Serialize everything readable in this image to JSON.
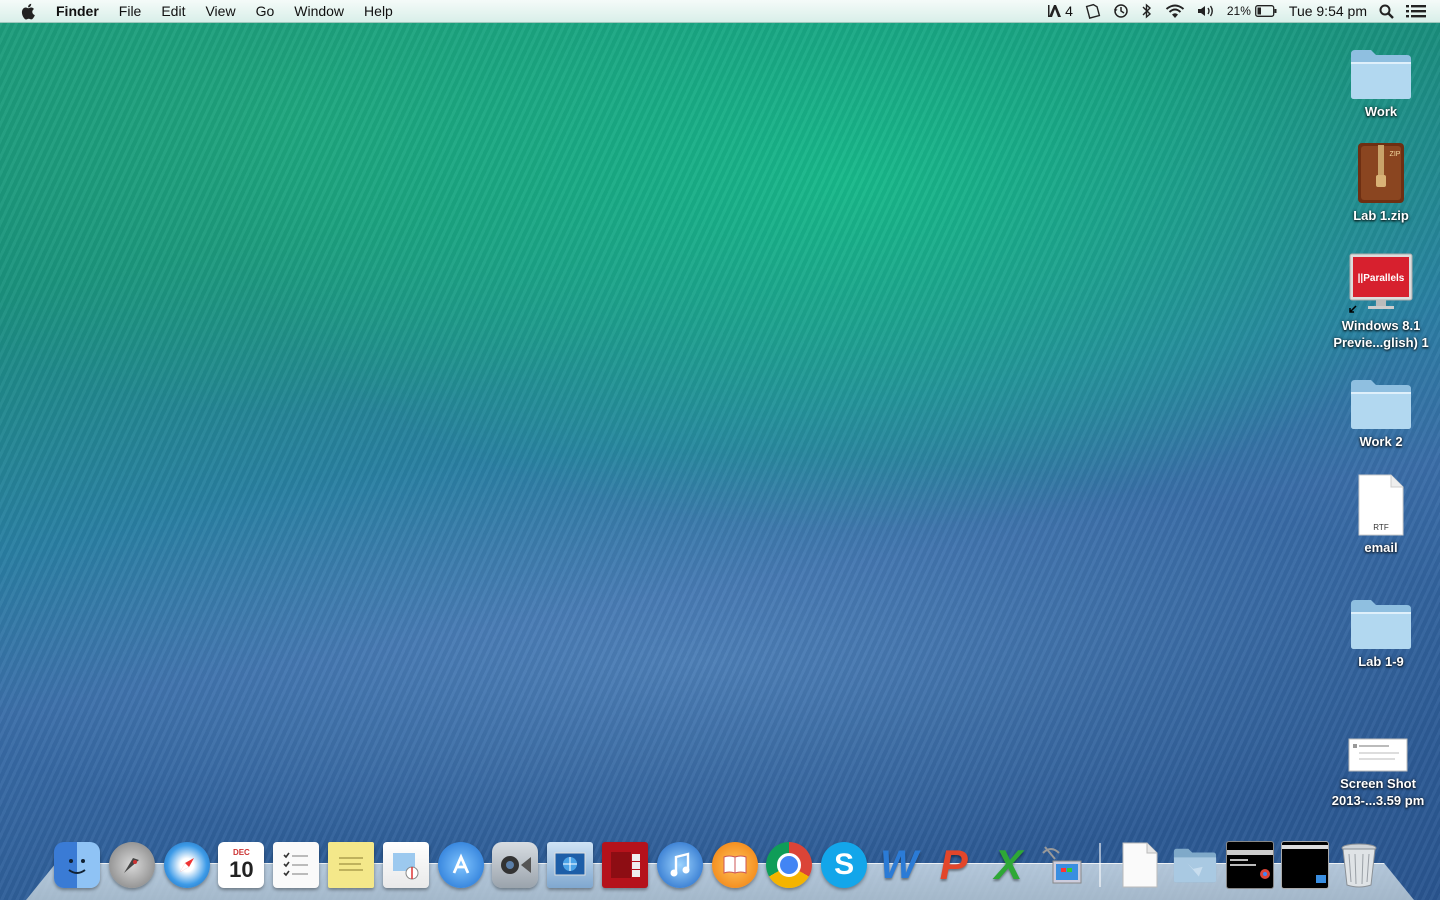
{
  "menubar": {
    "app_name": "Finder",
    "menus": [
      "File",
      "Edit",
      "View",
      "Go",
      "Window",
      "Help"
    ],
    "status": {
      "adobe_count": "4",
      "battery_percent": "21%",
      "clock": "Tue 9:54 pm"
    },
    "icons": [
      "apple-icon",
      "adobe-icon",
      "notifications-icon",
      "time-machine-icon",
      "bluetooth-icon",
      "wifi-icon",
      "volume-icon",
      "battery-icon",
      "spotlight-icon",
      "notification-center-icon"
    ]
  },
  "desktop": {
    "items": [
      {
        "label": "Work",
        "type": "folder-icon"
      },
      {
        "label": "Lab 1.zip",
        "type": "zip-icon"
      },
      {
        "label": "Windows 8.1 Previe...glish) 1",
        "type": "parallels-vm-icon",
        "badge": "||Parallels"
      },
      {
        "label": "Work 2",
        "type": "folder-icon"
      },
      {
        "label": "email",
        "type": "rtf-document-icon",
        "badge": "RTF"
      },
      {
        "label": "Lab 1-9",
        "type": "folder-icon"
      },
      {
        "label": "Screen Shot 2013-...3.59 pm",
        "type": "screenshot-icon"
      }
    ],
    "zip_badge": "ZIP"
  },
  "dock": {
    "calendar": {
      "month": "DEC",
      "day": "10"
    },
    "apps": [
      {
        "name": "finder-icon"
      },
      {
        "name": "launchpad-icon"
      },
      {
        "name": "safari-icon"
      },
      {
        "name": "calendar-icon"
      },
      {
        "name": "reminders-icon"
      },
      {
        "name": "stickies-icon"
      },
      {
        "name": "preview-icon"
      },
      {
        "name": "app-store-icon"
      },
      {
        "name": "facetime-icon"
      },
      {
        "name": "network-utility-icon"
      },
      {
        "name": "photo-booth-icon"
      },
      {
        "name": "itunes-icon"
      },
      {
        "name": "ibooks-icon"
      },
      {
        "name": "chrome-icon"
      },
      {
        "name": "skype-icon"
      },
      {
        "name": "word-icon"
      },
      {
        "name": "powerpoint-icon"
      },
      {
        "name": "excel-icon"
      },
      {
        "name": "remote-desktop-icon"
      }
    ],
    "word_letter": "W",
    "powerpoint_letter": "P",
    "excel_letter": "X",
    "skype_letter": "S",
    "others": [
      {
        "name": "document-stack-icon"
      },
      {
        "name": "folder-stack-icon"
      },
      {
        "name": "terminal-window-icon"
      },
      {
        "name": "window-thumbnail-icon"
      },
      {
        "name": "trash-icon"
      }
    ]
  },
  "colors": {
    "menubar_bg": "#e6f4f0",
    "folder_blue": "#9ecbe8",
    "zip_brown": "#7a3a1a",
    "parallels_red": "#d7202e",
    "word_blue": "#2b7bd6",
    "powerpoint_red": "#e2462a",
    "excel_green": "#2ea836"
  }
}
